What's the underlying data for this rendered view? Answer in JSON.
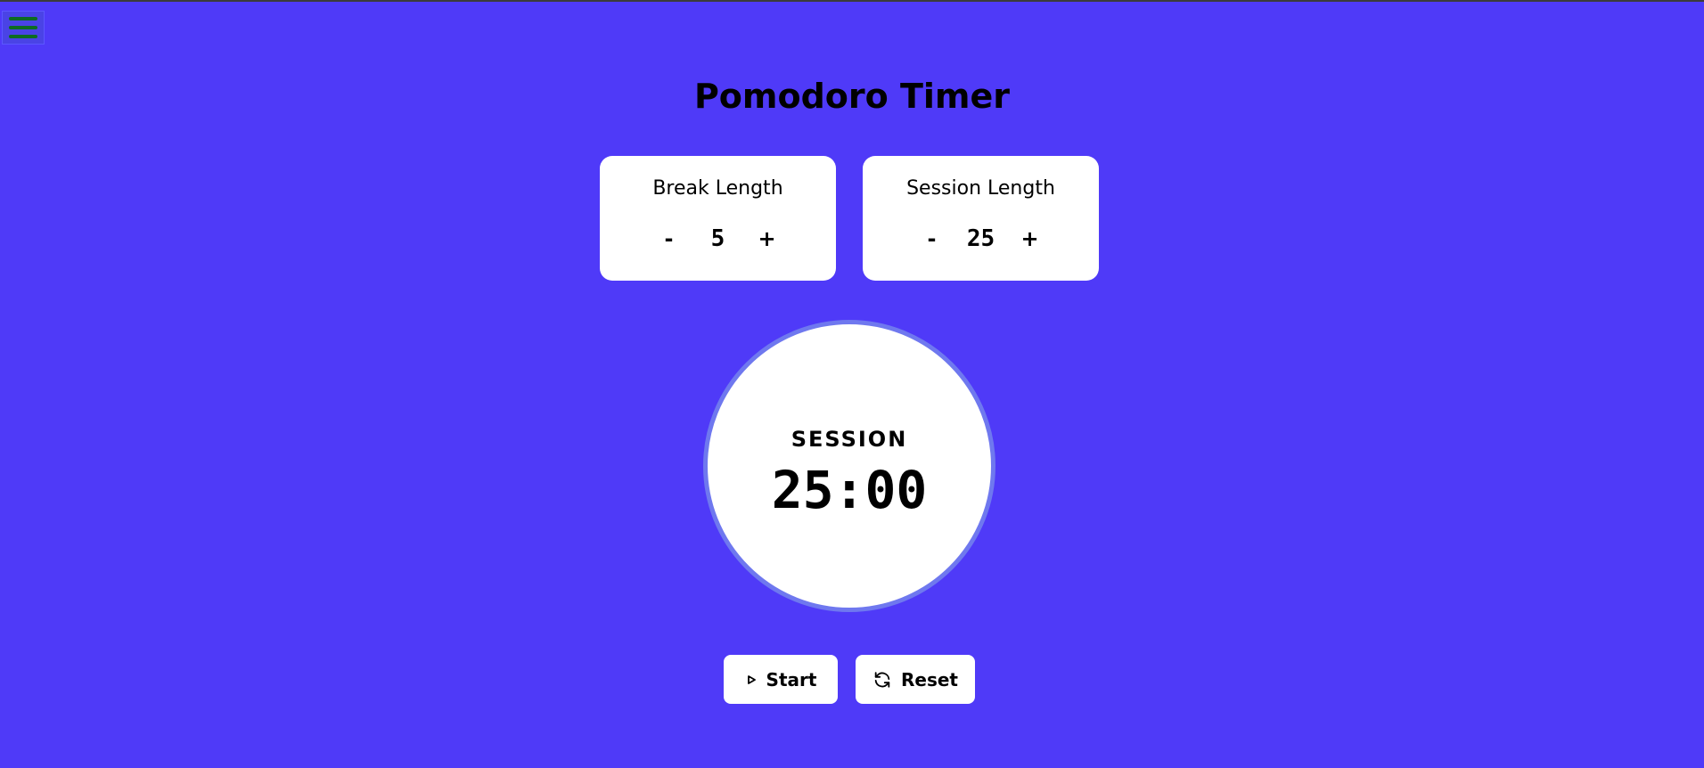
{
  "app": {
    "title": "Pomodoro Timer"
  },
  "break": {
    "label": "Break Length",
    "value": "5",
    "decrement": "-",
    "increment": "+"
  },
  "session": {
    "label": "Session Length",
    "value": "25",
    "decrement": "-",
    "increment": "+"
  },
  "timer": {
    "mode": "SESSION",
    "time": "25:00"
  },
  "buttons": {
    "start_label": "Start",
    "start_icon": "play-icon",
    "reset_label": "Reset",
    "reset_icon": "refresh-icon"
  },
  "menu": {
    "icon": "hamburger-menu-icon"
  },
  "colors": {
    "background": "#4f3af8",
    "card": "#ffffff",
    "circle_border": "#6f78ef",
    "menu_bars": "#0d6b22"
  }
}
